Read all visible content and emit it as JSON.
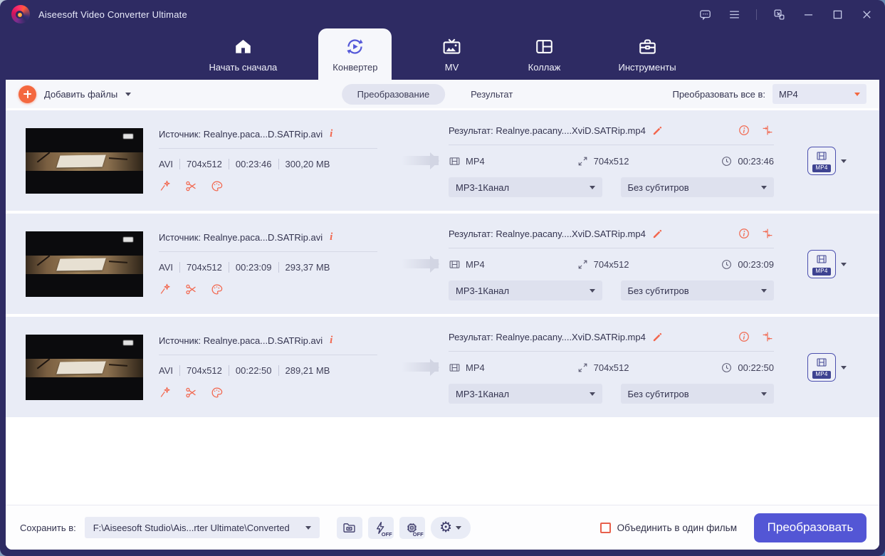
{
  "window": {
    "title": "Aiseesoft Video Converter Ultimate"
  },
  "titlebar": {
    "icons": [
      "feedback-bubble",
      "menu",
      "snapshot",
      "minimize",
      "maximize",
      "close"
    ]
  },
  "nav": {
    "tabs": [
      {
        "label": "Начать сначала",
        "icon": "home",
        "active": false
      },
      {
        "label": "Конвертер",
        "icon": "converter",
        "active": true
      },
      {
        "label": "MV",
        "icon": "mv-tv",
        "active": false
      },
      {
        "label": "Коллаж",
        "icon": "collage",
        "active": false
      },
      {
        "label": "Инструменты",
        "icon": "toolbox",
        "active": false
      }
    ]
  },
  "toolbar": {
    "add_files_label": "Добавить файлы",
    "view_tabs": [
      {
        "label": "Преобразование",
        "active": true
      },
      {
        "label": "Результат",
        "active": false
      }
    ],
    "convert_all_label": "Преобразовать все в:",
    "convert_all_value": "MP4"
  },
  "icons": {
    "info_glyph": "i",
    "edit_tools": [
      "magic-wand",
      "scissors",
      "palette"
    ]
  },
  "files": [
    {
      "source_label": "Источник: Realnye.paca...D.SATRip.avi",
      "format": "AVI",
      "resolution": "704x512",
      "duration": "00:23:46",
      "size": "300,20 MB",
      "result_label": "Результат: Realnye.pacany....XviD.SATRip.mp4",
      "out_format": "MP4",
      "out_resolution": "704x512",
      "out_duration": "00:23:46",
      "audio_option": "MP3-1Канал",
      "subtitle_option": "Без субтитров",
      "profile_badge": "MP4"
    },
    {
      "source_label": "Источник: Realnye.paca...D.SATRip.avi",
      "format": "AVI",
      "resolution": "704x512",
      "duration": "00:23:09",
      "size": "293,37 MB",
      "result_label": "Результат: Realnye.pacany....XviD.SATRip.mp4",
      "out_format": "MP4",
      "out_resolution": "704x512",
      "out_duration": "00:23:09",
      "audio_option": "MP3-1Канал",
      "subtitle_option": "Без субтитров",
      "profile_badge": "MP4"
    },
    {
      "source_label": "Источник: Realnye.paca...D.SATRip.avi",
      "format": "AVI",
      "resolution": "704x512",
      "duration": "00:22:50",
      "size": "289,21 MB",
      "result_label": "Результат: Realnye.pacany....XviD.SATRip.mp4",
      "out_format": "MP4",
      "out_resolution": "704x512",
      "out_duration": "00:22:50",
      "audio_option": "MP3-1Канал",
      "subtitle_option": "Без субтитров",
      "profile_badge": "MP4"
    }
  ],
  "footer": {
    "save_label": "Сохранить в:",
    "save_path": "F:\\Aiseesoft Studio\\Ais...rter Ultimate\\Converted",
    "accel_off_label": "OFF",
    "merge_label": "Объединить в один фильм",
    "merge_checked": false,
    "convert_label": "Преобразовать"
  },
  "colors": {
    "header_bg": "#2e2b63",
    "accent_orange": "#f2674e",
    "brand_purple": "#5356d5",
    "row_bg": "#e9ecf6"
  }
}
